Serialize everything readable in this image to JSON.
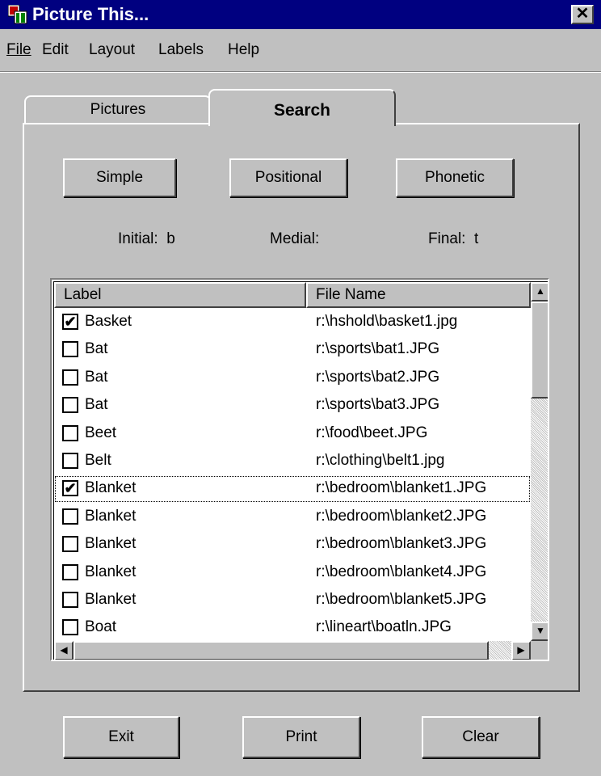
{
  "window": {
    "title": "Picture This..."
  },
  "menu": [
    "File",
    "Edit",
    "Layout",
    "Labels",
    "Help"
  ],
  "tabs": {
    "pictures": "Pictures",
    "search": "Search"
  },
  "search_buttons": {
    "simple": "Simple",
    "positional": "Positional",
    "phonetic": "Phonetic"
  },
  "sounds": {
    "initial_label": "Initial:",
    "initial_value": "b",
    "medial_label": "Medial:",
    "medial_value": "",
    "final_label": "Final:",
    "final_value": "t"
  },
  "table": {
    "columns": {
      "label": "Label",
      "file": "File Name"
    },
    "rows": [
      {
        "label": "Basket",
        "file": "r:\\hshold\\basket1.jpg",
        "checked": true
      },
      {
        "label": "Bat",
        "file": "r:\\sports\\bat1.JPG",
        "checked": false
      },
      {
        "label": "Bat",
        "file": "r:\\sports\\bat2.JPG",
        "checked": false
      },
      {
        "label": "Bat",
        "file": "r:\\sports\\bat3.JPG",
        "checked": false
      },
      {
        "label": "Beet",
        "file": "r:\\food\\beet.JPG",
        "checked": false
      },
      {
        "label": "Belt",
        "file": "r:\\clothing\\belt1.jpg",
        "checked": false
      },
      {
        "label": "Blanket",
        "file": "r:\\bedroom\\blanket1.JPG",
        "checked": true
      },
      {
        "label": "Blanket",
        "file": "r:\\bedroom\\blanket2.JPG",
        "checked": false
      },
      {
        "label": "Blanket",
        "file": "r:\\bedroom\\blanket3.JPG",
        "checked": false
      },
      {
        "label": "Blanket",
        "file": "r:\\bedroom\\blanket4.JPG",
        "checked": false
      },
      {
        "label": "Blanket",
        "file": "r:\\bedroom\\blanket5.JPG",
        "checked": false
      },
      {
        "label": "Boat",
        "file": "r:\\lineart\\boatln.JPG",
        "checked": false
      }
    ],
    "focused_row": 6
  },
  "bottom_buttons": {
    "exit": "Exit",
    "print": "Print",
    "clear": "Clear"
  },
  "icons": {
    "close": "close-icon",
    "checkmark": "✔",
    "up": "▲",
    "down": "▼",
    "left": "◀",
    "right": "▶"
  },
  "colors": {
    "titlebar": "#000080",
    "face": "#c0c0c0"
  }
}
